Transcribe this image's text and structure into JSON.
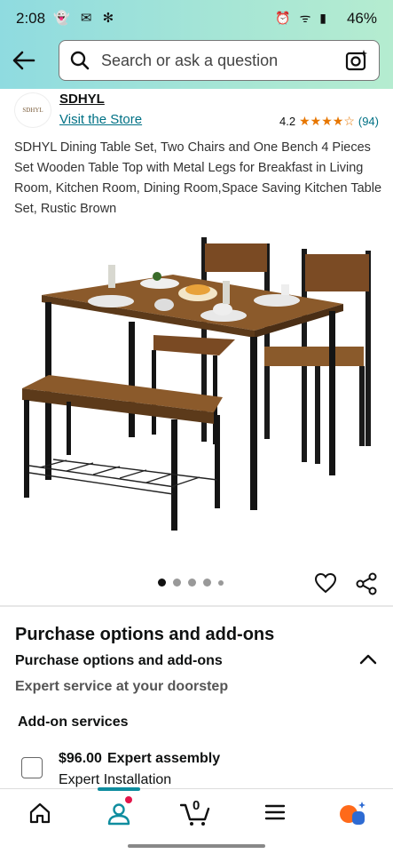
{
  "status": {
    "time": "2:08",
    "battery": "46%"
  },
  "search": {
    "placeholder": "Search or ask a question"
  },
  "brand": {
    "logo_text": "SDHYL",
    "name": "SDHYL",
    "visit_store": "Visit the Store",
    "rating_value": "4.2",
    "rating_stars": 4.2,
    "review_count": "(94)"
  },
  "product": {
    "title": "SDHYL Dining Table Set, Two Chairs and One Bench 4 Pieces Set Wooden Table Top with Metal Legs for Breakfast in Living Room, Kitchen Room, Dining Room,Space Saving Kitchen Table Set, Rustic Brown",
    "image_count": 5,
    "active_image": 1
  },
  "purchase": {
    "section_title": "Purchase options and add-ons",
    "subsection_title": "Purchase options and add-ons",
    "expert_service": "Expert service at your doorstep",
    "addon_label": "Add-on services",
    "addon_price": "$96.00",
    "addon_name": "Expert assembly",
    "addon_detail": "Expert Installation"
  },
  "nav": {
    "cart_count": "0",
    "items": [
      "home-icon",
      "profile-icon",
      "cart-icon",
      "menu-icon",
      "ai-assistant-icon"
    ]
  },
  "colors": {
    "header_gradient_start": "#8fdbe0",
    "header_gradient_end": "#b5ecd0",
    "link": "#007185",
    "star": "#e77600",
    "accent_teal": "#0f8d9f"
  }
}
